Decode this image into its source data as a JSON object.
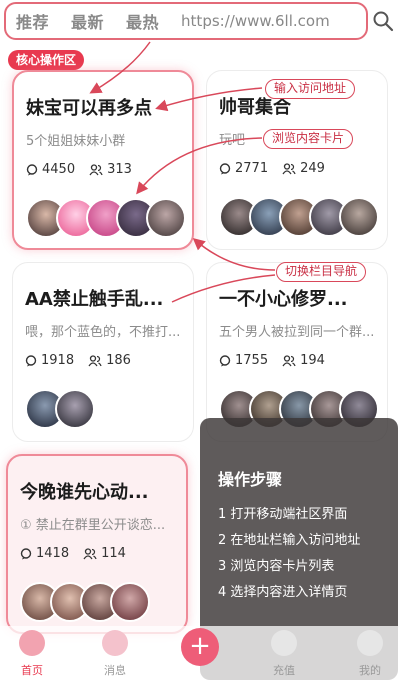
{
  "header": {
    "tabs": [
      "推荐",
      "最新",
      "最热"
    ],
    "url": "https://www.6ll.com",
    "search_icon": "search-icon"
  },
  "section_tag": "核心操作区",
  "callouts": {
    "enter_address": "输入访问地址",
    "browse_cards": "浏览内容卡片",
    "switch_nav": "切换栏目导航"
  },
  "cards": [
    {
      "title": "妹宝可以再多点",
      "desc": "5个姐姐妹妹小群",
      "comments": "4450",
      "members": "313"
    },
    {
      "title": "帅哥集合",
      "desc": "玩吧",
      "comments": "2771",
      "members": "249"
    },
    {
      "title": "AA禁止触手乱...",
      "desc": "喂，那个蓝色的，不推打...",
      "comments": "1918",
      "members": "186"
    },
    {
      "title": "一不小心修罗...",
      "desc": "五个男人被拉到同一个群...",
      "comments": "1755",
      "members": "194"
    },
    {
      "title": "今晚谁先心动...",
      "desc": "① 禁止在群里公开谈恋...",
      "comments": "1418",
      "members": "114"
    }
  ],
  "steps": {
    "title": "操作步骤",
    "items": [
      "1 打开移动端社区界面",
      "2 在地址栏输入访问地址",
      "3 浏览内容卡片列表",
      "4 选择内容进入详情页"
    ]
  },
  "bottom_nav": {
    "home": "首页",
    "messages": "消息",
    "recharge": "充值",
    "mine": "我的"
  },
  "colors": {
    "accent": "#e8394f",
    "highlight_border": "#ef8a98",
    "fab": "#ee5d78"
  }
}
